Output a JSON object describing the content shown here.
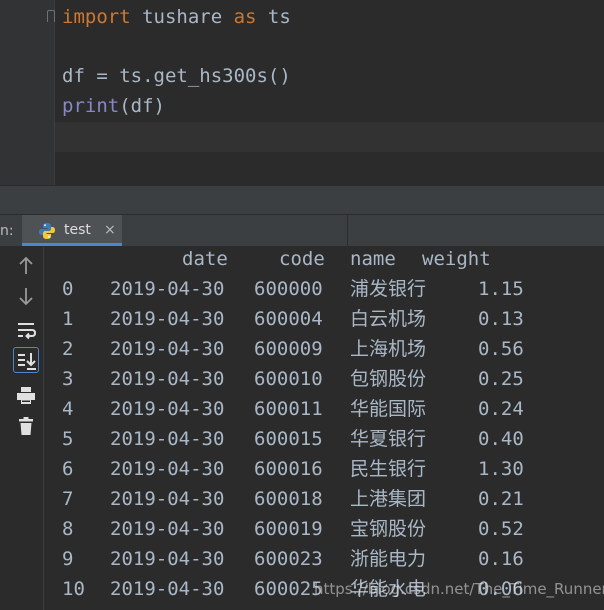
{
  "editor": {
    "lines": [
      {
        "kw_import": "import",
        "module": " tushare ",
        "kw_as": "as",
        "alias": " ts"
      },
      {
        "text": ""
      },
      {
        "text": "df = ts.get_hs300s()"
      },
      {
        "builtin": "print",
        "rest": "(df)"
      }
    ]
  },
  "run_panel": {
    "prefix": "n:",
    "tab_label": "test",
    "tab_close": "×"
  },
  "toolbar": {
    "buttons": [
      "up-arrow-icon",
      "down-arrow-icon",
      "soft-wrap-icon",
      "scroll-to-end-icon",
      "print-icon",
      "trash-icon"
    ]
  },
  "console": {
    "headers": {
      "date": "date",
      "code": "code",
      "name": "name",
      "weight": "weight"
    },
    "rows": [
      {
        "idx": "0",
        "date": "2019-04-30",
        "code": "600000",
        "name": "浦发银行",
        "weight": "1.15"
      },
      {
        "idx": "1",
        "date": "2019-04-30",
        "code": "600004",
        "name": "白云机场",
        "weight": "0.13"
      },
      {
        "idx": "2",
        "date": "2019-04-30",
        "code": "600009",
        "name": "上海机场",
        "weight": "0.56"
      },
      {
        "idx": "3",
        "date": "2019-04-30",
        "code": "600010",
        "name": "包钢股份",
        "weight": "0.25"
      },
      {
        "idx": "4",
        "date": "2019-04-30",
        "code": "600011",
        "name": "华能国际",
        "weight": "0.24"
      },
      {
        "idx": "5",
        "date": "2019-04-30",
        "code": "600015",
        "name": "华夏银行",
        "weight": "0.40"
      },
      {
        "idx": "6",
        "date": "2019-04-30",
        "code": "600016",
        "name": "民生银行",
        "weight": "1.30"
      },
      {
        "idx": "7",
        "date": "2019-04-30",
        "code": "600018",
        "name": "上港集团",
        "weight": "0.21"
      },
      {
        "idx": "8",
        "date": "2019-04-30",
        "code": "600019",
        "name": "宝钢股份",
        "weight": "0.52"
      },
      {
        "idx": "9",
        "date": "2019-04-30",
        "code": "600023",
        "name": "浙能电力",
        "weight": "0.16"
      },
      {
        "idx": "10",
        "date": "2019-04-30",
        "code": "600025",
        "name": "华能水电",
        "weight": "0.06"
      }
    ]
  },
  "watermark": "https://blog.csdn.net/The_Time_Runner"
}
